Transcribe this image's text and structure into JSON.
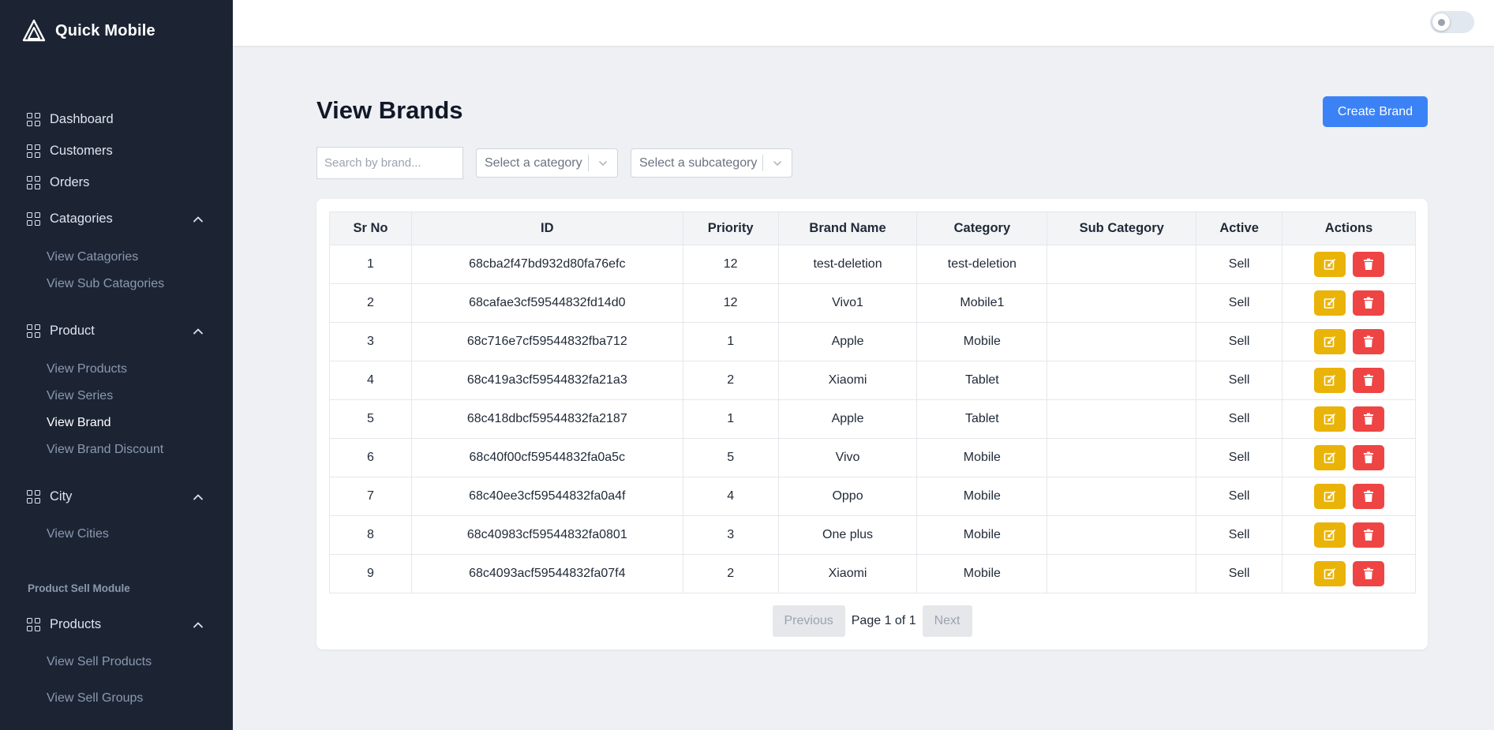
{
  "app": {
    "name": "Quick Mobile"
  },
  "sidebar": {
    "items": [
      {
        "label": "Dashboard",
        "icon": "grid-icon"
      },
      {
        "label": "Customers",
        "icon": "grid-icon"
      },
      {
        "label": "Orders",
        "icon": "grid-icon"
      },
      {
        "label": "Catagories",
        "icon": "grid-icon",
        "expanded": true,
        "children": [
          "View Catagories",
          "View Sub Catagories"
        ]
      },
      {
        "label": "Product",
        "icon": "grid-icon",
        "expanded": true,
        "children": [
          "View Products",
          "View Series",
          "View Brand",
          "View Brand Discount"
        ],
        "active_child": "View Brand"
      },
      {
        "label": "City",
        "icon": "grid-icon",
        "expanded": true,
        "children": [
          "View Cities"
        ]
      }
    ],
    "section_title": "Product Sell Module",
    "section_items": [
      {
        "label": "Products",
        "icon": "grid-icon",
        "expanded": true,
        "children": [
          "View Sell Products",
          "View Sell Groups"
        ]
      }
    ]
  },
  "header": {
    "theme_toggle": "dark-mode-toggle"
  },
  "main": {
    "title": "View Brands",
    "create_label": "Create Brand",
    "search_placeholder": "Search by brand...",
    "category_select": "Select a category",
    "subcategory_select": "Select a subcategory",
    "columns": [
      "Sr No",
      "ID",
      "Priority",
      "Brand Name",
      "Category",
      "Sub Category",
      "Active",
      "Actions"
    ],
    "rows": [
      {
        "sr": "1",
        "id": "68cba2f47bd932d80fa76efc",
        "priority": "12",
        "brand": "test-deletion",
        "category": "test-deletion",
        "sub": "",
        "active": "Sell"
      },
      {
        "sr": "2",
        "id": "68cafae3cf59544832fd14d0",
        "priority": "12",
        "brand": "Vivo1",
        "category": "Mobile1",
        "sub": "",
        "active": "Sell"
      },
      {
        "sr": "3",
        "id": "68c716e7cf59544832fba712",
        "priority": "1",
        "brand": "Apple",
        "category": "Mobile",
        "sub": "",
        "active": "Sell"
      },
      {
        "sr": "4",
        "id": "68c419a3cf59544832fa21a3",
        "priority": "2",
        "brand": "Xiaomi",
        "category": "Tablet",
        "sub": "",
        "active": "Sell"
      },
      {
        "sr": "5",
        "id": "68c418dbcf59544832fa2187",
        "priority": "1",
        "brand": "Apple",
        "category": "Tablet",
        "sub": "",
        "active": "Sell"
      },
      {
        "sr": "6",
        "id": "68c40f00cf59544832fa0a5c",
        "priority": "5",
        "brand": "Vivo",
        "category": "Mobile",
        "sub": "",
        "active": "Sell"
      },
      {
        "sr": "7",
        "id": "68c40ee3cf59544832fa0a4f",
        "priority": "4",
        "brand": "Oppo",
        "category": "Mobile",
        "sub": "",
        "active": "Sell"
      },
      {
        "sr": "8",
        "id": "68c40983cf59544832fa0801",
        "priority": "3",
        "brand": "One plus",
        "category": "Mobile",
        "sub": "",
        "active": "Sell"
      },
      {
        "sr": "9",
        "id": "68c4093acf59544832fa07f4",
        "priority": "2",
        "brand": "Xiaomi",
        "category": "Mobile",
        "sub": "",
        "active": "Sell"
      }
    ],
    "pagination": {
      "prev": "Previous",
      "info": "Page 1 of 1",
      "next": "Next"
    }
  },
  "colors": {
    "sidebar_bg": "#1c2434",
    "primary": "#3b82f6",
    "edit": "#eab308",
    "delete": "#ef4444"
  }
}
